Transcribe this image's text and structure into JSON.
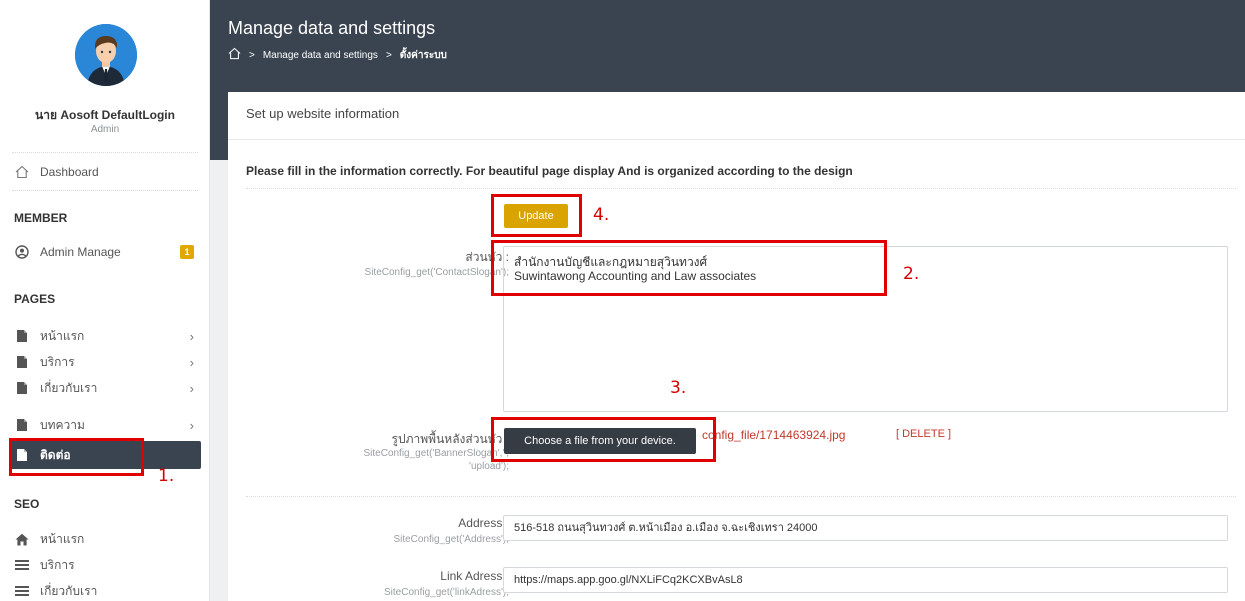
{
  "sidebar": {
    "user_name": "นาย Aosoft DefaultLogin",
    "user_role": "Admin",
    "dashboard": "Dashboard",
    "member_heading": "MEMBER",
    "admin_manage": "Admin Manage",
    "admin_badge": "1",
    "pages_heading": "PAGES",
    "pages": [
      "หน้าแรก",
      "บริการ",
      "เกี่ยวกับเรา",
      "บทความ"
    ],
    "active_page": "ติดต่อ",
    "seo_heading": "SEO",
    "seo_items": [
      "หน้าแรก",
      "บริการ",
      "เกี่ยวกับเรา"
    ]
  },
  "header": {
    "title": "Manage data and settings",
    "breadcrumb": [
      "Manage data and settings",
      "ตั้งค่าระบบ"
    ]
  },
  "panel": {
    "title": "Set up website information",
    "notice": "Please fill in the information correctly. For beautiful page display And is organized according to the design",
    "update_label": "Update",
    "slogan": {
      "label": "ส่วนหัว :",
      "code": "SiteConfig_get('ContactSlogan');",
      "value": "สำนักงานบัญชีและกฎหมายสุวินทวงศ์\nSuwintawong Accounting and Law associates"
    },
    "banner": {
      "label": "รูปภาพพื้นหลังส่วนหัว :",
      "code1": "SiteConfig_get('BannerSlogan','',",
      "code2": "'upload');",
      "choose_label": "Choose a file from your device.",
      "file_path": "config_file/1714463924.jpg",
      "delete_label": "[ DELETE ]"
    },
    "address": {
      "label": "Address :",
      "code": "SiteConfig_get('Address');",
      "value": "516-518 ถนนสุวินทวงศ์ ต.หน้าเมือง อ.เมือง จ.ฉะเชิงเทรา 24000"
    },
    "link_address": {
      "label": "Link Adress :",
      "code": "SiteConfig_get('linkAdress');",
      "value": "https://maps.app.goo.gl/NXLiFCq2KCXBvAsL8"
    }
  },
  "annotations": [
    "1.",
    "2.",
    "3.",
    "4."
  ],
  "colors": {
    "accent": "#d9a400",
    "dark": "#3a4450",
    "annotation": "#e00000"
  }
}
